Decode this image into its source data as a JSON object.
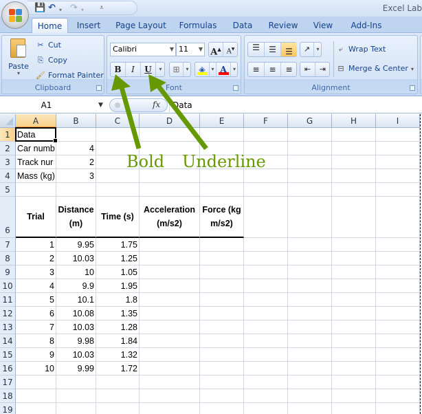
{
  "app": {
    "title": "Excel Lab",
    "qat_icons": [
      "save-icon",
      "undo-icon",
      "redo-icon",
      "customize-qat-icon"
    ]
  },
  "tabs": [
    {
      "label": "Home",
      "active": true
    },
    {
      "label": "Insert"
    },
    {
      "label": "Page Layout"
    },
    {
      "label": "Formulas"
    },
    {
      "label": "Data"
    },
    {
      "label": "Review"
    },
    {
      "label": "View"
    },
    {
      "label": "Add-Ins"
    }
  ],
  "ribbon": {
    "clipboard": {
      "label": "Clipboard",
      "paste": "Paste",
      "cut": "Cut",
      "copy": "Copy",
      "format_painter": "Format Painter"
    },
    "font": {
      "label": "Font",
      "font_name": "Calibri",
      "font_size": "11",
      "grow": "A",
      "shrink": "A",
      "bold": "B",
      "italic": "I",
      "underline": "U",
      "fill_color": "#ffff00",
      "font_color": "#ff0000"
    },
    "alignment": {
      "label": "Alignment",
      "wrap_text": "Wrap Text",
      "merge_center": "Merge & Center"
    }
  },
  "formula_bar": {
    "name_box": "A1",
    "fx": "fx",
    "value": "Data"
  },
  "sheet": {
    "columns": [
      "A",
      "B",
      "C",
      "D",
      "E",
      "F",
      "G",
      "H",
      "I"
    ],
    "selected_column": "A",
    "rows": [
      "1",
      "2",
      "3",
      "4",
      "5",
      "6",
      "7",
      "8",
      "9",
      "10",
      "11",
      "12",
      "13",
      "14",
      "15",
      "16",
      "17",
      "18",
      "19"
    ],
    "selected_row": "1",
    "info_cells": [
      {
        "label": "Data",
        "value": ""
      },
      {
        "label": "Car numb",
        "value": "4"
      },
      {
        "label": "Track nur",
        "value": "2"
      },
      {
        "label": "Mass (kg)",
        "value": "3"
      }
    ],
    "table_headers": [
      "Trial",
      "Distance (m)",
      "Time (s)",
      "Acceleration (m/s2)",
      "Force (kg m/s2)"
    ],
    "table_rows": [
      [
        "1",
        "9.95",
        "1.75"
      ],
      [
        "2",
        "10.03",
        "1.25"
      ],
      [
        "3",
        "10",
        "1.05"
      ],
      [
        "4",
        "9.9",
        "1.95"
      ],
      [
        "5",
        "10.1",
        "1.8"
      ],
      [
        "6",
        "10.08",
        "1.35"
      ],
      [
        "7",
        "10.03",
        "1.28"
      ],
      [
        "8",
        "9.98",
        "1.84"
      ],
      [
        "9",
        "10.03",
        "1.32"
      ],
      [
        "10",
        "9.99",
        "1.72"
      ]
    ]
  },
  "annotations": {
    "bold_label": "Bold",
    "underline_label": "Underline",
    "color": "#669900"
  }
}
